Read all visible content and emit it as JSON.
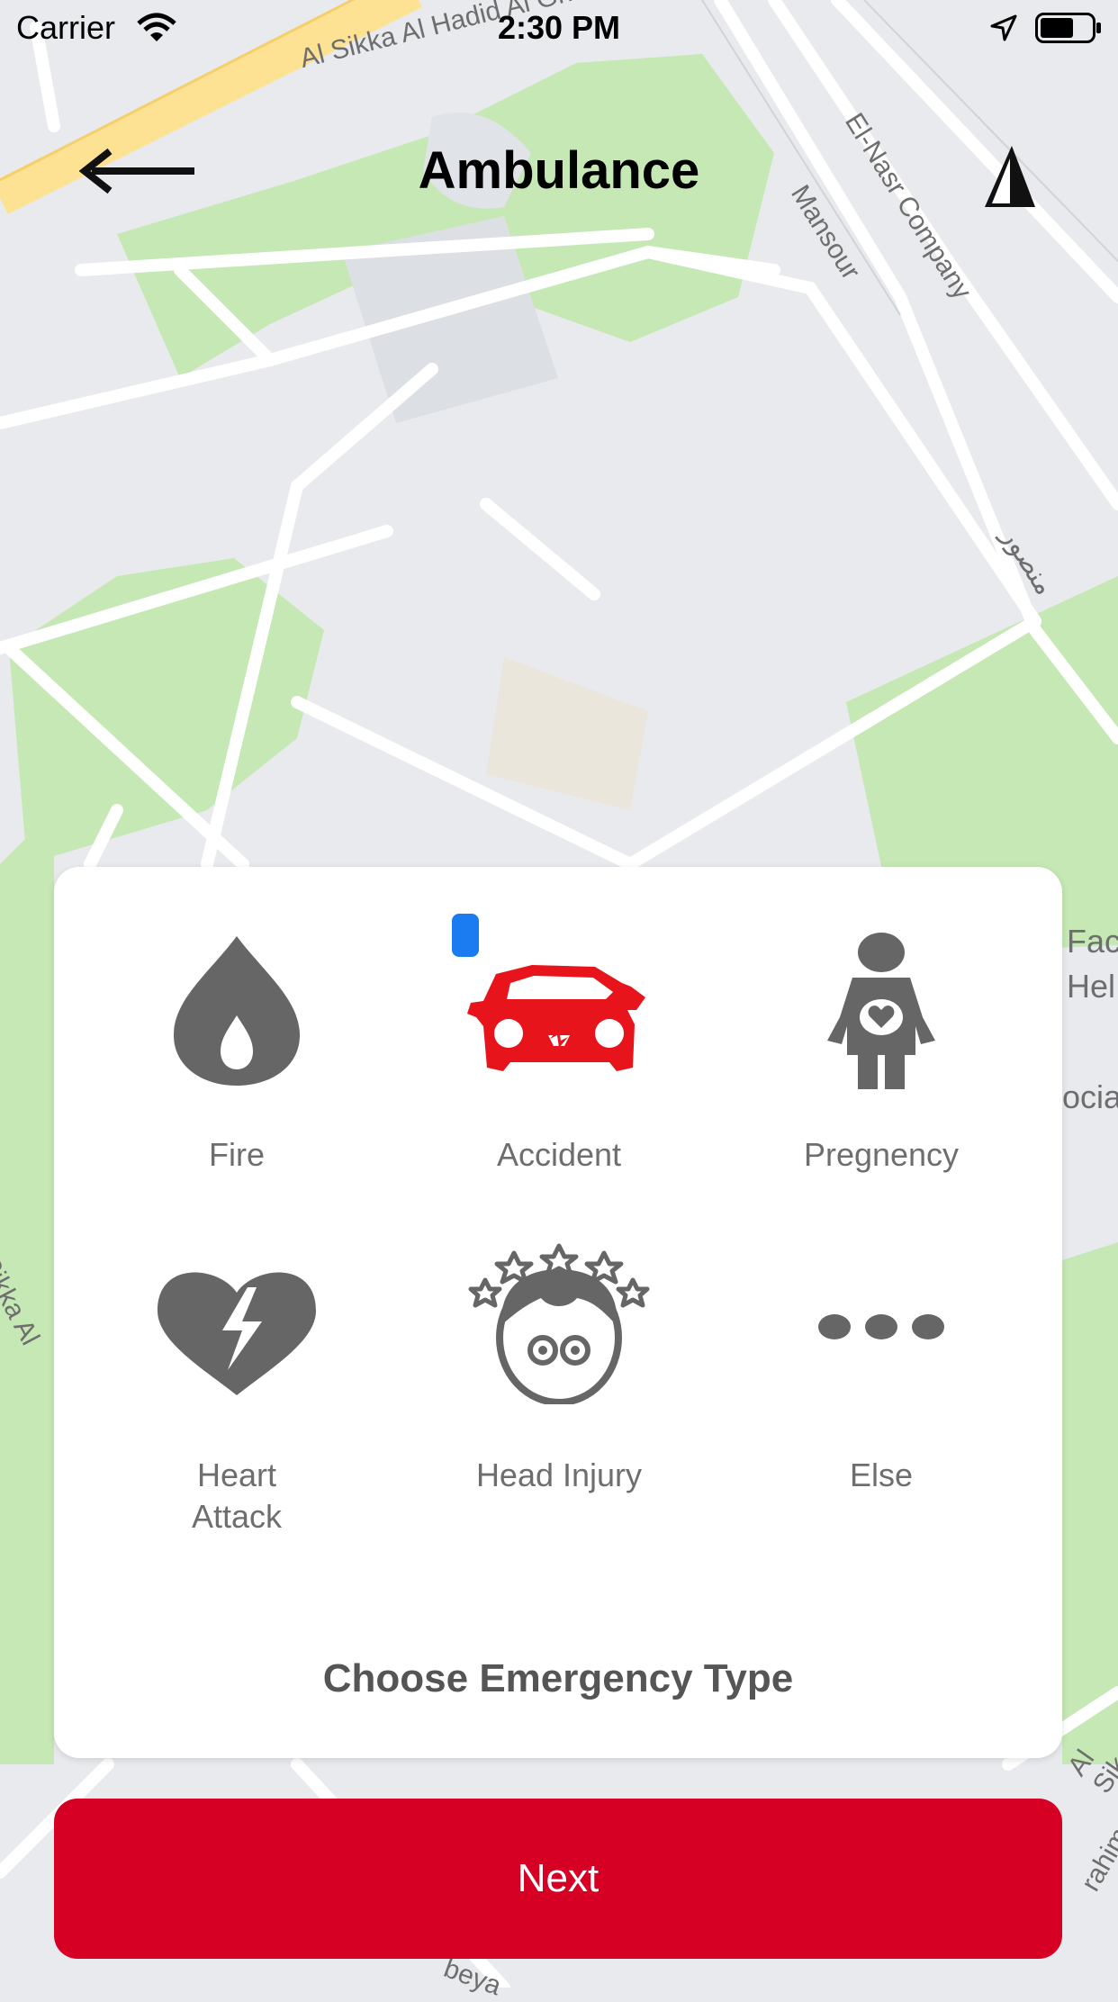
{
  "status_bar": {
    "carrier": "Carrier",
    "time": "2:30 PM"
  },
  "header": {
    "title": "Ambulance",
    "back_icon": "back-arrow-icon",
    "location_icon": "navigation-arrow-icon"
  },
  "map": {
    "labels": [
      "Al Sikka Al Hadid Al Gharbeya",
      "El-Nasr Company",
      "Mansour",
      "منصور",
      "Fac",
      "Hel",
      "ocia",
      "Sikka Al",
      "Al Sik",
      "beya",
      "rahim"
    ],
    "colors": {
      "land": "#e8eaed",
      "park": "#c5e8b5",
      "road": "#ffffff",
      "highway": "#fde293"
    }
  },
  "emergency": {
    "options": [
      {
        "label": "Fire",
        "icon": "fire-drop-icon",
        "selected": false
      },
      {
        "label": "Accident",
        "icon": "car-accident-icon",
        "selected": true
      },
      {
        "label": "Pregnency",
        "icon": "pregnant-woman-icon",
        "selected": false
      },
      {
        "label": "Heart\nAttack",
        "icon": "broken-heart-icon",
        "selected": false
      },
      {
        "label": "Head Injury",
        "icon": "head-injury-icon",
        "selected": false
      },
      {
        "label": "Else",
        "icon": "more-dots-icon",
        "selected": false
      }
    ],
    "caption": "Choose Emergency Type"
  },
  "footer": {
    "next_label": "Next"
  },
  "colors": {
    "accent": "#d60024",
    "icon_gray": "#666666",
    "selected_icon": "#e8141c",
    "selector_dot": "#1a7cf0"
  }
}
